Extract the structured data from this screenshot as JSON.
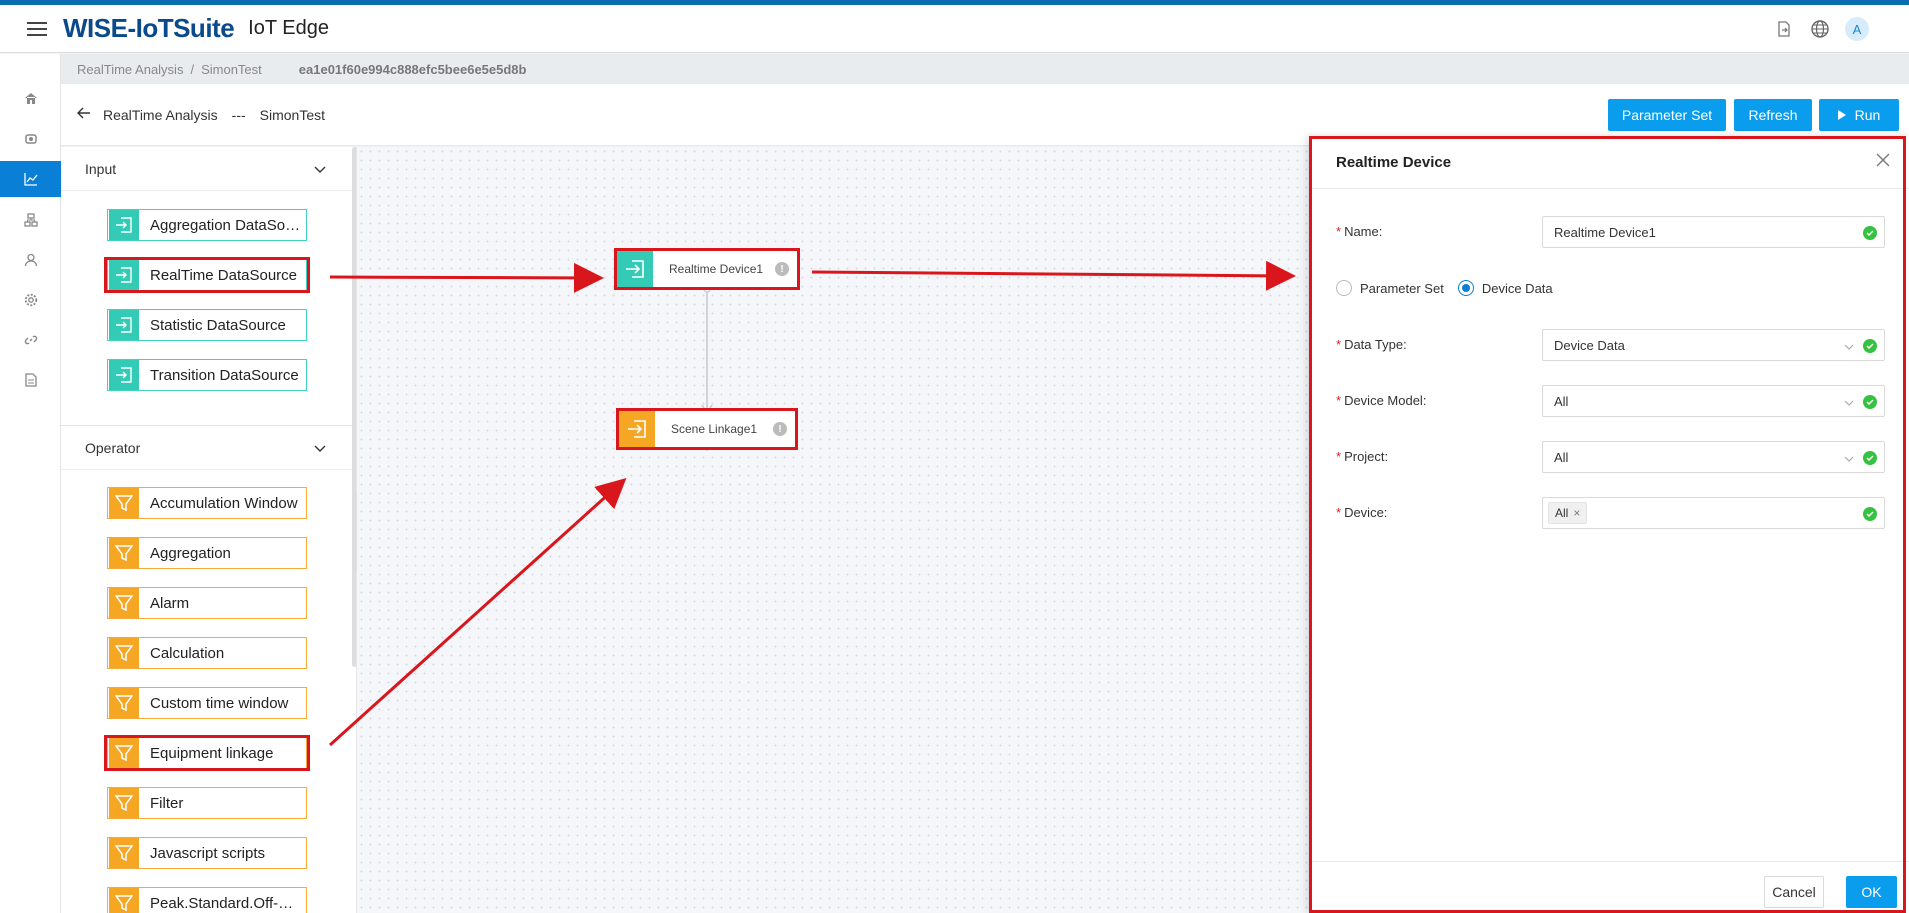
{
  "header": {
    "brand": "WISE-IoTSuite",
    "product": "IoT Edge",
    "avatar_letter": "A",
    "icons": [
      "export-icon",
      "globe-icon"
    ]
  },
  "sidenav": {
    "items": [
      "home-icon",
      "device-icon",
      "chart-icon",
      "topology-icon",
      "user-icon",
      "gear-icon",
      "link-icon",
      "report-icon"
    ],
    "active_index": 2
  },
  "breadcrumb": {
    "items": [
      "RealTime Analysis",
      "SimonTest"
    ],
    "separator": "/",
    "id": "ea1e01f60e994c888efc5bee6e5e5d8b"
  },
  "toolbar": {
    "back_title": "RealTime Analysis",
    "dash": "---",
    "back_sub": "SimonTest",
    "parameter_set": "Parameter Set",
    "refresh": "Refresh",
    "run": "Run"
  },
  "palette": {
    "input_title": "Input",
    "input_items": [
      "Aggregation DataSource",
      "RealTime DataSource",
      "Statistic DataSource",
      "Transition DataSource"
    ],
    "operator_title": "Operator",
    "operator_items": [
      "Accumulation Window",
      "Aggregation",
      "Alarm",
      "Calculation",
      "Custom time window",
      "Equipment linkage",
      "Filter",
      "Javascript scripts",
      "Peak.Standard.Off-Peak"
    ]
  },
  "canvas": {
    "node1": "Realtime Device1",
    "node2": "Scene Linkage1",
    "info_glyph": "!"
  },
  "drawer": {
    "title": "Realtime Device",
    "name_label": "Name:",
    "name_value": "Realtime Device1",
    "radio_param": "Parameter Set",
    "radio_device": "Device Data",
    "data_type_label": "Data Type:",
    "data_type_value": "Device Data",
    "device_model_label": "Device Model:",
    "device_model_value": "All",
    "project_label": "Project:",
    "project_value": "All",
    "device_label": "Device:",
    "device_tag": "All",
    "cancel": "Cancel",
    "ok": "OK"
  },
  "colors": {
    "primary": "#0a9dee",
    "brand": "#0a4a8a",
    "input_teal": "#33cbb6",
    "operator_orange": "#f5a623",
    "highlight_red": "#d9161c",
    "success_green": "#35c240"
  }
}
